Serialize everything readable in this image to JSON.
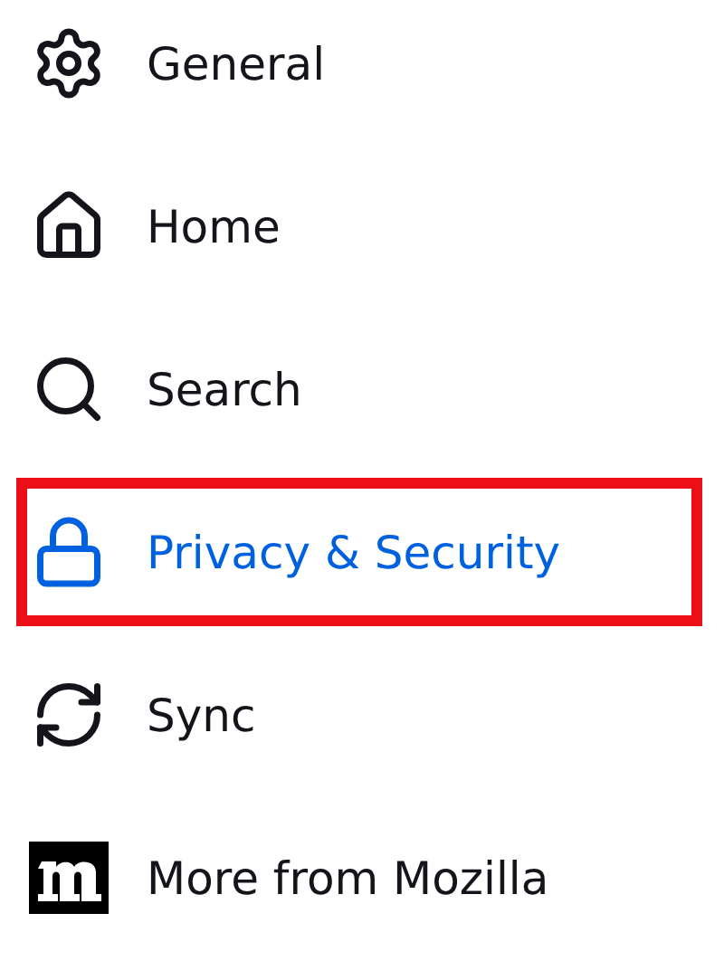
{
  "sidebar": {
    "items": [
      {
        "kind": "gear",
        "label": "General",
        "selected": false,
        "highlighted": false
      },
      {
        "kind": "home",
        "label": "Home",
        "selected": false,
        "highlighted": false
      },
      {
        "kind": "search",
        "label": "Search",
        "selected": false,
        "highlighted": false
      },
      {
        "kind": "lock",
        "label": "Privacy & Security",
        "selected": true,
        "highlighted": true
      },
      {
        "kind": "sync",
        "label": "Sync",
        "selected": false,
        "highlighted": false
      },
      {
        "kind": "mozilla",
        "label": "More from Mozilla",
        "selected": false,
        "highlighted": false
      }
    ]
  }
}
